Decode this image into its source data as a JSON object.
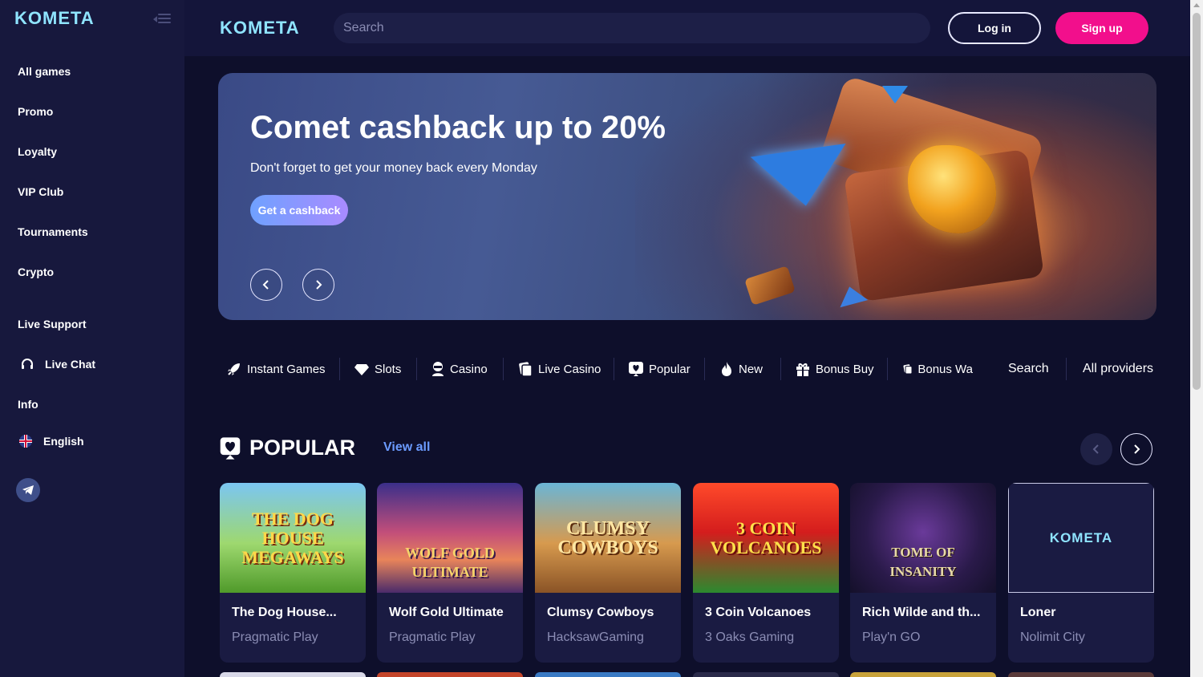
{
  "brand": {
    "logo_text": "KOMETA"
  },
  "sidebar": {
    "items": [
      {
        "label": "All games"
      },
      {
        "label": "Promo"
      },
      {
        "label": "Loyalty"
      },
      {
        "label": "VIP Club"
      },
      {
        "label": "Tournaments"
      },
      {
        "label": "Crypto"
      },
      {
        "label": "Live Support"
      },
      {
        "label": "Live Chat"
      },
      {
        "label": "Info"
      },
      {
        "label": "English"
      }
    ]
  },
  "header": {
    "search_placeholder": "Search",
    "login_label": "Log in",
    "signup_label": "Sign up"
  },
  "banner": {
    "title": "Comet cashback up to 20%",
    "subtitle": "Don't forget to get your money back every Monday",
    "cta_label": "Get a cashback"
  },
  "categories": {
    "tabs": [
      {
        "label": "Instant Games",
        "icon": "rocket-icon"
      },
      {
        "label": "Slots",
        "icon": "diamond-icon"
      },
      {
        "label": "Casino",
        "icon": "dealer-icon"
      },
      {
        "label": "Live Casino",
        "icon": "cards-icon"
      },
      {
        "label": "Popular",
        "icon": "heart-icon"
      },
      {
        "label": "New",
        "icon": "fire-icon"
      },
      {
        "label": "Bonus Buy",
        "icon": "gift-icon"
      },
      {
        "label": "Bonus Wa",
        "icon": "cards-icon"
      }
    ],
    "search_label": "Search",
    "providers_label": "All providers"
  },
  "popular": {
    "title": "POPULAR",
    "view_all_label": "View all",
    "games": [
      {
        "name": "The Dog House...",
        "provider": "Pragmatic Play",
        "art_text": "THE DOG HOUSE MEGAWAYS"
      },
      {
        "name": "Wolf Gold Ultimate",
        "provider": "Pragmatic Play",
        "art_text": "WOLF GOLD ULTIMATE"
      },
      {
        "name": "Clumsy Cowboys",
        "provider": "HacksawGaming",
        "art_text": "CLUMSY COWBOYS"
      },
      {
        "name": "3 Coin Volcanoes",
        "provider": "3 Oaks Gaming",
        "art_text": "3 COIN VOLCANOES"
      },
      {
        "name": "Rich Wilde and th...",
        "provider": "Play'n GO",
        "art_text": "TOME OF INSANITY"
      },
      {
        "name": "Loner",
        "provider": "Nolimit City",
        "art_text": "KOMETA"
      }
    ]
  },
  "colors": {
    "background": "#0e0f2b",
    "sidebar": "#17183d",
    "accent_pink": "#f20f8c",
    "link_blue": "#6b9bff",
    "logo_cyan": "#8fe4ff"
  }
}
